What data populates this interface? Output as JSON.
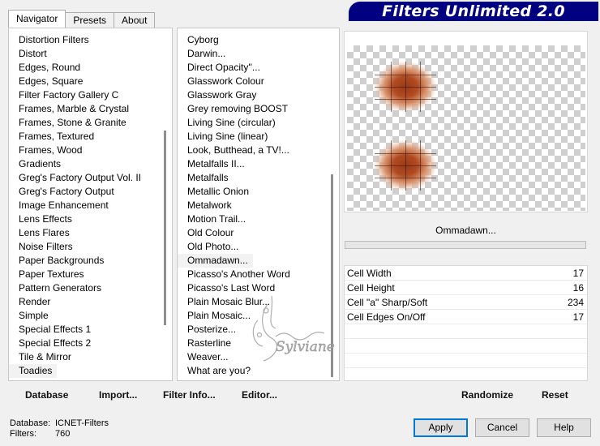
{
  "tabs": [
    {
      "label": "Navigator",
      "active": true
    },
    {
      "label": "Presets",
      "active": false
    },
    {
      "label": "About",
      "active": false
    }
  ],
  "title": "Filters Unlimited 2.0",
  "categories": [
    "Distortion Filters",
    "Distort",
    "Edges, Round",
    "Edges, Square",
    "Filter Factory Gallery C",
    "Frames, Marble & Crystal",
    "Frames, Stone & Granite",
    "Frames, Textured",
    "Frames, Wood",
    "Gradients",
    "Greg's Factory Output Vol. II",
    "Greg's Factory Output",
    "Image Enhancement",
    "Lens Effects",
    "Lens Flares",
    "Noise Filters",
    "Paper Backgrounds",
    "Paper Textures",
    "Pattern Generators",
    "Render",
    "Simple",
    "Special Effects 1",
    "Special Effects 2",
    "Tile & Mirror",
    "Toadies"
  ],
  "selected_category": "Toadies",
  "filters": [
    "Cyborg",
    "Darwin...",
    "Direct Opacity''...",
    "Glasswork Colour",
    "Glasswork Gray",
    "Grey removing BOOST",
    "Living Sine (circular)",
    "Living Sine (linear)",
    "Look, Butthead, a TV!...",
    "Metalfalls II...",
    "Metalfalls",
    "Metallic Onion",
    "Metalwork",
    "Motion Trail...",
    "Old Colour",
    "Old Photo...",
    "Ommadawn...",
    "Picasso's Another Word",
    "Picasso's Last Word",
    "Plain Mosaic Blur...",
    "Plain Mosaic...",
    "Posterize...",
    "Rasterline",
    "Weaver...",
    "What are you?"
  ],
  "selected_filter": "Ommadawn...",
  "current_filter_label": "Ommadawn...",
  "params": [
    {
      "name": "Cell Width",
      "value": "17"
    },
    {
      "name": "Cell Height",
      "value": "16"
    },
    {
      "name": "Cell \"a\" Sharp/Soft",
      "value": "234"
    },
    {
      "name": "Cell Edges On/Off",
      "value": "17"
    }
  ],
  "bottom_links": {
    "database": "Database",
    "import": "Import...",
    "filter_info": "Filter Info...",
    "editor": "Editor...",
    "randomize": "Randomize",
    "reset": "Reset"
  },
  "info": {
    "database_label": "Database:",
    "database_value": "ICNET-Filters",
    "filters_label": "Filters:",
    "filters_value": "760"
  },
  "buttons": {
    "apply": "Apply",
    "cancel": "Cancel",
    "help": "Help"
  },
  "watermark_text": "Sylviane",
  "colors": {
    "title_bg": "#000080",
    "preview_blob": "#b04a22"
  }
}
